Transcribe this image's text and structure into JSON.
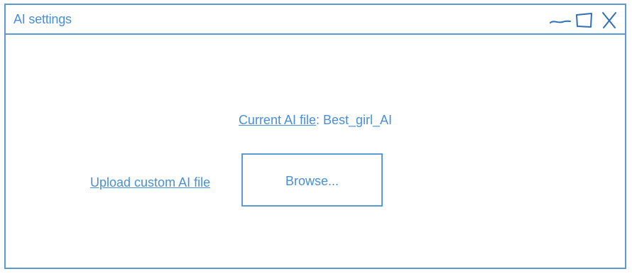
{
  "window": {
    "title": "AI settings",
    "controls": {
      "minimize_icon": "minimize-icon",
      "maximize_icon": "maximize-icon",
      "close_icon": "close-icon"
    }
  },
  "content": {
    "current_ai_label": "Current AI file",
    "current_ai_separator": ": ",
    "current_ai_value": "Best_girl_AI",
    "upload_link": "Upload custom AI file",
    "browse_button": "Browse..."
  },
  "colors": {
    "accent": "#5b9bd5",
    "text": "#4a8fd4",
    "background": "#ffffff"
  }
}
